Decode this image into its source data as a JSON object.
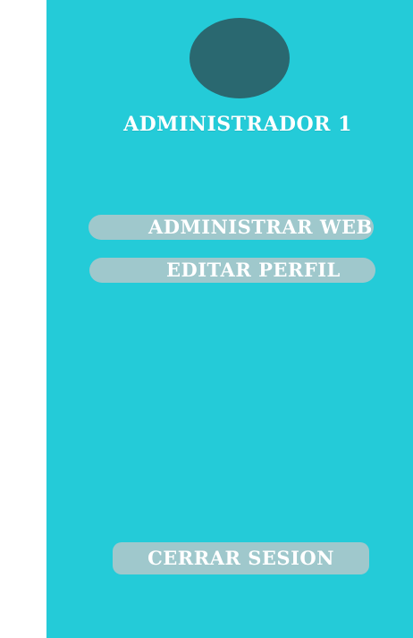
{
  "profile": {
    "name": "ADMINISTRADOR 1"
  },
  "menu": {
    "admin_web_label": "ADMINISTRAR WEB",
    "edit_profile_label": "EDITAR PERFIL"
  },
  "footer": {
    "logout_label": "CERRAR SESION"
  },
  "colors": {
    "panel": "#24cbd8",
    "avatar": "#2a6870",
    "button": "#9fc8cc",
    "text": "#ffffff"
  }
}
